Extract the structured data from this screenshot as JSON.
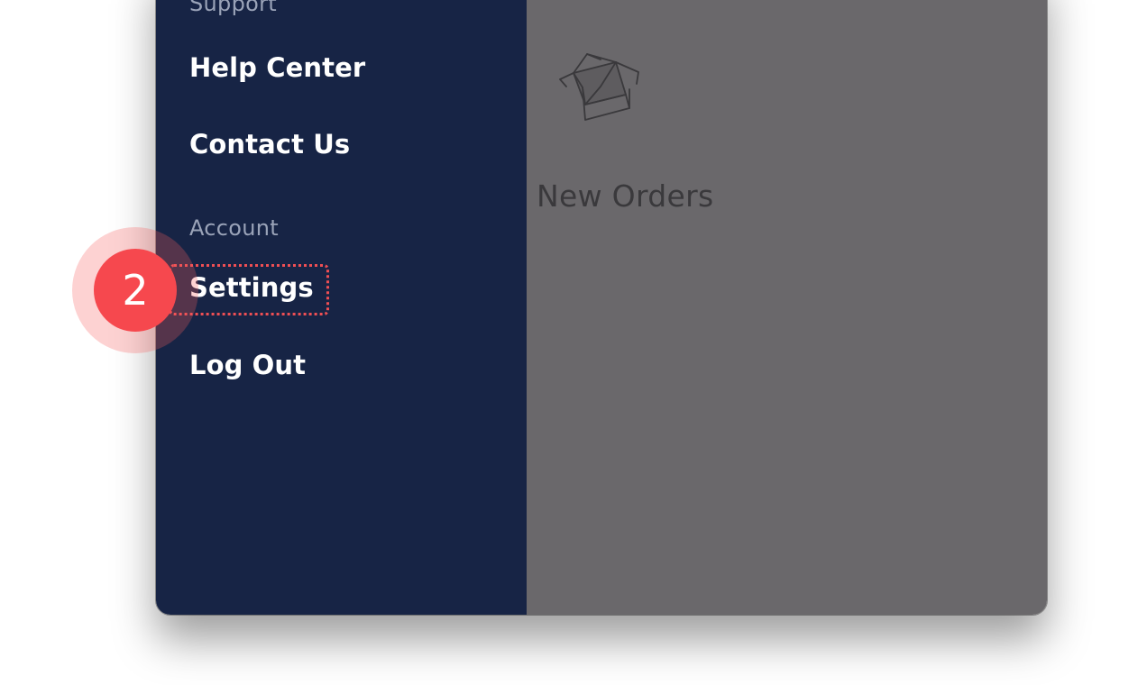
{
  "sidebar": {
    "support_label": "Support",
    "support_items": [
      {
        "label": "Help Center"
      },
      {
        "label": "Contact Us"
      }
    ],
    "account_label": "Account",
    "account_items": [
      {
        "label": "Settings"
      },
      {
        "label": "Log Out"
      }
    ]
  },
  "main": {
    "empty_state_icon": "open-box-icon",
    "empty_state_title": "New Orders"
  },
  "annotation": {
    "step_number": "2",
    "color": "#f6484e"
  },
  "colors": {
    "sidebar_bg": "#172445",
    "overlay_bg": "#6a686b"
  }
}
